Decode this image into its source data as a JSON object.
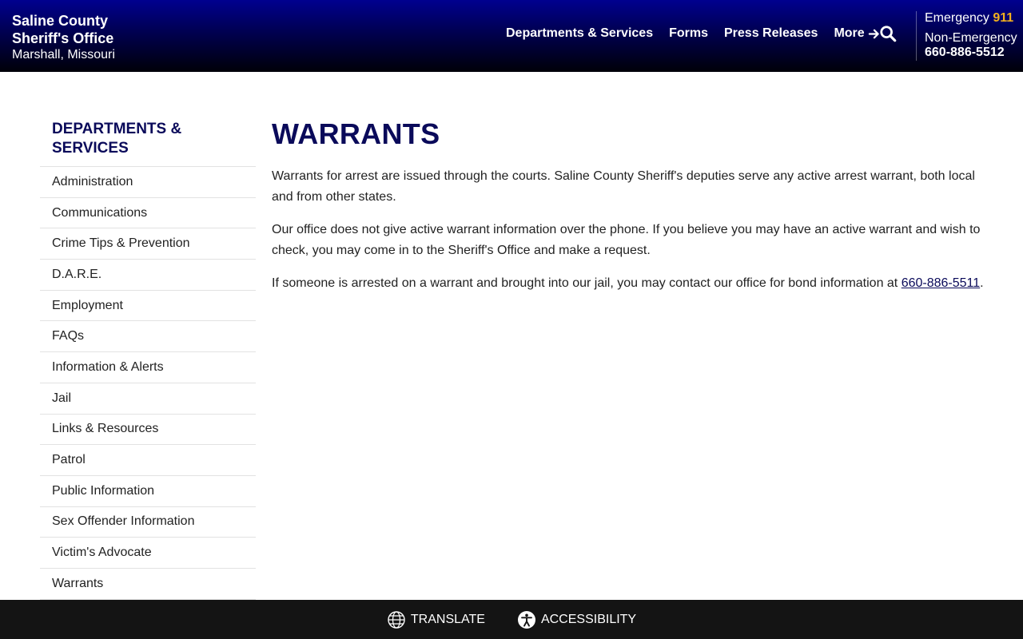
{
  "brand": {
    "line1": "Saline County",
    "line2": "Sheriff's Office",
    "line3": "Marshall, Missouri"
  },
  "nav": {
    "items": [
      "Departments & Services",
      "Forms",
      "Press Releases"
    ],
    "more_label": "More",
    "search_icon": "search-icon"
  },
  "contact": {
    "emergency_label": "Emergency",
    "emergency_number": "911",
    "nonemergency_label": "Non-Emergency",
    "nonemergency_number": "660-886-5512"
  },
  "sidebar": {
    "heading": "DEPARTMENTS & SERVICES",
    "items": [
      {
        "label": "Administration"
      },
      {
        "label": "Communications"
      },
      {
        "label": "Crime Tips & Prevention"
      },
      {
        "label": "D.A.R.E."
      },
      {
        "label": "Employment"
      },
      {
        "label": "FAQs"
      },
      {
        "label": "Information & Alerts"
      },
      {
        "label": "Jail"
      },
      {
        "label": "Links & Resources"
      },
      {
        "label": "Patrol"
      },
      {
        "label": "Public Information"
      },
      {
        "label": "Sex Offender Information"
      },
      {
        "label": "Victim's Advocate"
      },
      {
        "label": "Warrants"
      }
    ]
  },
  "main": {
    "title": "WARRANTS",
    "p1": "Warrants for arrest are issued through the courts. Saline County Sheriff's deputies serve any active arrest warrant, both local and from other states.",
    "p2": "Our office does not give active warrant information over the phone. If you believe you may have an active warrant and wish to check, you may come in to the Sheriff's Office and make a request.",
    "p3_text": "If someone is arrested on a warrant and brought into our jail, you may contact our office for bond information at ",
    "p3_phone": "660-886-5511",
    "p3_end": "."
  },
  "footerbar": {
    "translate_label": "TRANSLATE",
    "accessibility_label": "ACCESSIBILITY"
  },
  "colors": {
    "header_top": "#00008f",
    "header_bottom": "#000008",
    "heading_navy": "#0a0a5a",
    "emergency_accent": "#f2b01e",
    "footer_bar": "#141414"
  }
}
